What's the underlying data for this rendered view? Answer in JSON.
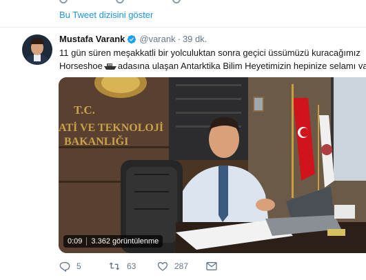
{
  "thread": {
    "show_label": "Bu Tweet dizisini göster"
  },
  "tweet": {
    "author_name": "Mustafa Varank",
    "author_handle": "@varank",
    "separator": "·",
    "time": "39 dk.",
    "text_line1": "11 gün süren meşakkatli bir yolculuktan sonra geçici üssümüzü kuracağımız",
    "text_line2_a": "Horseshoe",
    "text_line2_b": "adasına ulaşan Antarktika Bilim Heyetimizin hepinize selamı var."
  },
  "video": {
    "duration": "0:09",
    "views": "3.362 görüntülenme",
    "sign_tc": "T.C.",
    "sign_line2": "ATİ VE TEKNOLOJİ",
    "sign_line3": "BAKANLIĞI"
  },
  "actions": {
    "reply_count": "5",
    "retweet_count": "63",
    "like_count": "287"
  },
  "colors": {
    "link": "#1b95e0",
    "muted": "#657786",
    "verified": "#1da1f2"
  }
}
